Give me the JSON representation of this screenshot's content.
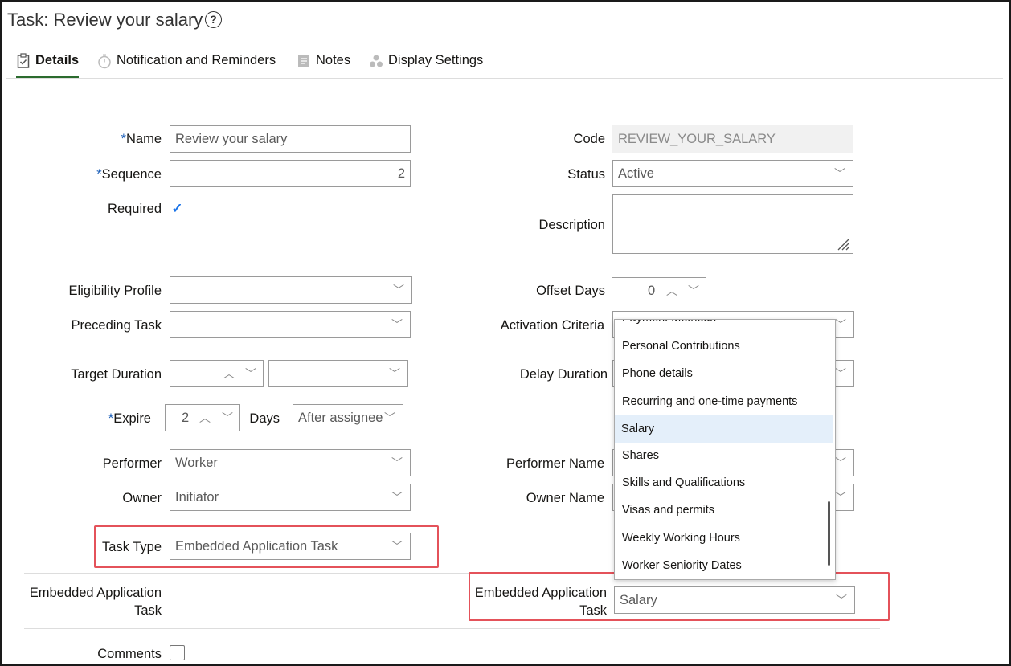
{
  "page": {
    "title": "Task: Review your salary",
    "help_glyph": "?"
  },
  "tabs": [
    {
      "label": "Details",
      "icon": "clipboard-icon",
      "active": true
    },
    {
      "label": "Notification and Reminders",
      "icon": "stopwatch-icon",
      "active": false
    },
    {
      "label": "Notes",
      "icon": "notes-icon",
      "active": false
    },
    {
      "label": "Display Settings",
      "icon": "display-settings-icon",
      "active": false
    }
  ],
  "form": {
    "name": {
      "label": "Name",
      "value": "Review your salary"
    },
    "sequence": {
      "label": "Sequence",
      "value": "2"
    },
    "required": {
      "label": "Required",
      "checked": true
    },
    "code": {
      "label": "Code",
      "value": "REVIEW_YOUR_SALARY"
    },
    "status": {
      "label": "Status",
      "value": "Active"
    },
    "description": {
      "label": "Description",
      "value": ""
    },
    "eligibility_profile": {
      "label": "Eligibility Profile",
      "value": ""
    },
    "preceding_task": {
      "label": "Preceding Task",
      "value": ""
    },
    "offset_days": {
      "label": "Offset Days",
      "value": "0"
    },
    "activation_criteria": {
      "label": "Activation Criteria"
    },
    "target_duration": {
      "label": "Target Duration",
      "value": "",
      "unit": ""
    },
    "delay_duration": {
      "label": "Delay Duration"
    },
    "expire": {
      "label": "Expire",
      "value": "2",
      "unit_label": "Days",
      "relative": "After assignee"
    },
    "performer": {
      "label": "Performer",
      "value": "Worker"
    },
    "owner": {
      "label": "Owner",
      "value": "Initiator"
    },
    "performer_name": {
      "label": "Performer Name"
    },
    "owner_name": {
      "label": "Owner Name"
    },
    "task_type": {
      "label": "Task Type",
      "value": "Embedded Application Task"
    },
    "embedded_left": {
      "label_line1": "Embedded Application",
      "label_line2": "Task"
    },
    "embedded_right": {
      "label_line1": "Embedded Application",
      "label_line2": "Task",
      "value": "Salary"
    },
    "comments": {
      "label": "Comments",
      "checked": false
    }
  },
  "dropdown": {
    "items": [
      "Payment Methods",
      "Personal Contributions",
      "Phone details",
      "Recurring and one-time payments",
      "Salary",
      "Shares",
      "Skills and Qualifications",
      "Visas and permits",
      "Weekly Working Hours",
      "Worker Seniority Dates"
    ],
    "selected": "Salary"
  },
  "colors": {
    "required_star": "#1d60b9",
    "active_tab_underline": "#2b6b2e",
    "highlight_box": "#e4525a",
    "selected_item": "#e4effa"
  }
}
